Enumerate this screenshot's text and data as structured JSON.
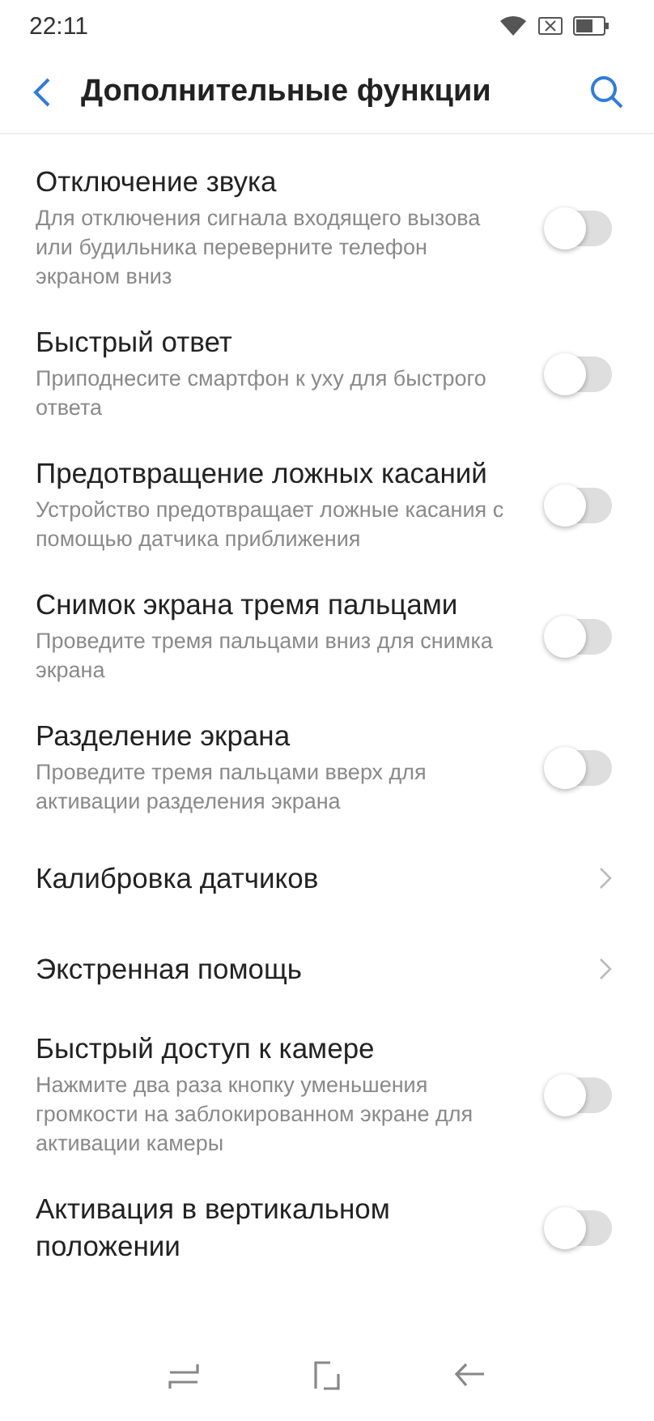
{
  "status_bar": {
    "time": "22:11"
  },
  "header": {
    "title": "Дополнительные функции"
  },
  "items": [
    {
      "kind": "toggle",
      "title": "Отключение звука",
      "description": "Для отключения сигнала входящего вызова или будильника переверните телефон экраном вниз",
      "on": false
    },
    {
      "kind": "toggle",
      "title": "Быстрый ответ",
      "description": "Приподнесите смартфон к уху для быстрого ответа",
      "on": false
    },
    {
      "kind": "toggle",
      "title": "Предотвращение ложных касаний",
      "description": "Устройство предотвращает ложные касания с помощью датчика приближения",
      "on": false
    },
    {
      "kind": "toggle",
      "title": "Снимок экрана тремя пальцами",
      "description": "Проведите тремя пальцами вниз для снимка экрана",
      "on": false
    },
    {
      "kind": "toggle",
      "title": "Разделение экрана",
      "description": "Проведите тремя пальцами вверх для активации разделения экрана",
      "on": false
    },
    {
      "kind": "link",
      "title": "Калибровка датчиков"
    },
    {
      "kind": "link",
      "title": "Экстренная помощь"
    },
    {
      "kind": "toggle",
      "title": "Быстрый доступ к камере",
      "description": "Нажмите два раза кнопку уменьшения громкости на заблокированном экране для активации камеры",
      "on": false
    },
    {
      "kind": "toggle",
      "title": "Активация в вертикальном положении",
      "on": false
    }
  ]
}
